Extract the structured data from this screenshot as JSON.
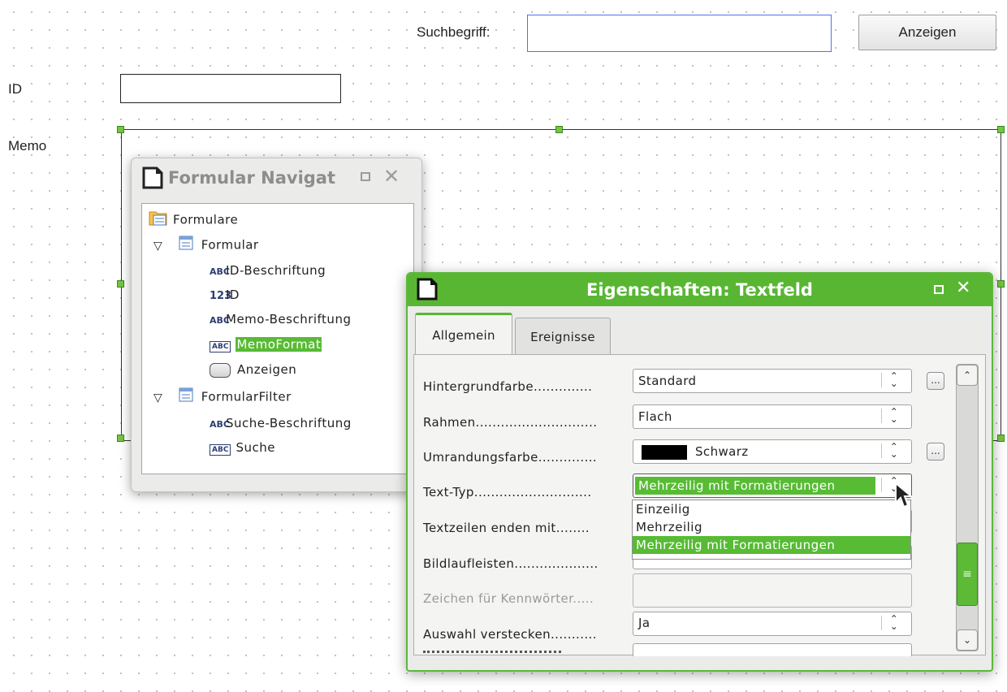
{
  "form": {
    "search_label": "Suchbegriff:",
    "show_button": "Anzeigen",
    "id_label": "ID",
    "memo_label": "Memo"
  },
  "navigator": {
    "title": "Formular Navigat",
    "tree": [
      {
        "label": "Formulare",
        "icon": "folder-icon"
      },
      {
        "label": "Formular",
        "icon": "form-icon",
        "expanded": true
      },
      {
        "label": "ID-Beschriftung",
        "icon": "ABC"
      },
      {
        "label": "ID",
        "icon": "123"
      },
      {
        "label": "Memo-Beschriftung",
        "icon": "ABC"
      },
      {
        "label": "MemoFormat",
        "icon": "ABC-box",
        "selected": true
      },
      {
        "label": "Anzeigen",
        "icon": "button-icon"
      },
      {
        "label": "FormularFilter",
        "icon": "form-icon",
        "expanded": true
      },
      {
        "label": "Suche-Beschriftung",
        "icon": "ABC"
      },
      {
        "label": "Suche",
        "icon": "ABC-box"
      }
    ],
    "icons": {
      "abc": "ABC",
      "num": "123"
    }
  },
  "properties": {
    "title": "Eigenschaften: Textfeld",
    "tabs": [
      "Allgemein",
      "Ereignisse"
    ],
    "rows": [
      {
        "label": "Hintergrundfarbe..............",
        "value": "Standard"
      },
      {
        "label": "Rahmen.............................",
        "value": "Flach"
      },
      {
        "label": "Umrandungsfarbe..............",
        "value": "Schwarz"
      },
      {
        "label": "Text-Typ............................",
        "value": "Mehrzeilig mit Formatierungen"
      },
      {
        "label": "Textzeilen enden mit........",
        "value": ""
      },
      {
        "label": "Bildlaufleisten....................",
        "value": ""
      },
      {
        "label": "Zeichen für Kennwörter.....",
        "value": ""
      },
      {
        "label": "Auswahl verstecken...........",
        "value": "Ja"
      }
    ],
    "dots": "...",
    "dropdown": [
      "Einzeilig",
      "Mehrzeilig",
      "Mehrzeilig mit Formatierungen"
    ]
  },
  "colors": {
    "accent": "#58b633",
    "search_border": "#5b6cf0",
    "selection": "#57bb34"
  }
}
